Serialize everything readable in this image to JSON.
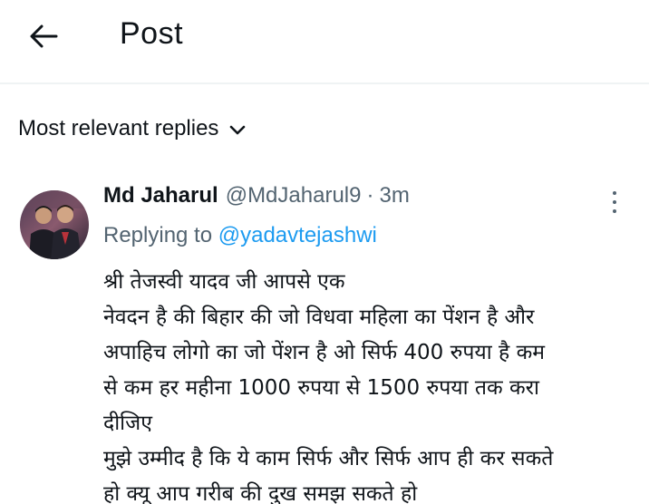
{
  "header": {
    "title": "Post"
  },
  "sort": {
    "label": "Most relevant replies"
  },
  "reply": {
    "author_name": "Md Jaharul",
    "author_handle": "@MdJaharul9",
    "separator": "·",
    "timestamp": "3m",
    "replying_prefix": "Replying to",
    "replying_to": "@yadavtejashwi",
    "text_lines": [
      "श्री तेजस्वी यादव जी आपसे एक",
      "नेवदन है की बिहार की जो विधवा महिला का पेंशन है और",
      "अपाहिच लोगो का जो पेंशन है ओ सिर्फ 400 रुपया है कम",
      "से कम हर महीना 1000 रुपया से 1500 रुपया तक करा",
      "दीजिए",
      "मुझे उम्मीद है कि ये काम सिर्फ और सिर्फ आप ही कर सकते",
      "हो क्यू आप गरीब की दुख समझ सकते हो"
    ]
  },
  "colors": {
    "text_primary": "#0f1419",
    "text_secondary": "#536471",
    "link": "#1d9bf0",
    "divider": "#eff3f4"
  },
  "icons": {
    "back": "arrow-left-icon",
    "sort": "chevron-down-icon",
    "more": "more-vertical-icon"
  }
}
